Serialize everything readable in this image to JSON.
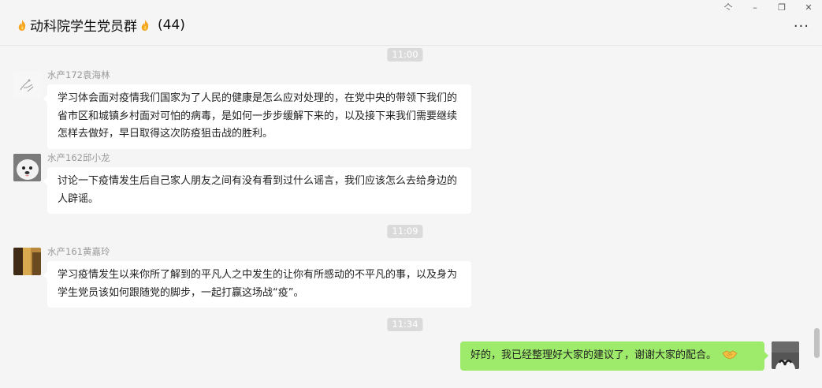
{
  "header": {
    "title": "动科院学生党员群",
    "count": "(44)",
    "window_controls": {
      "pin": "亽",
      "minimize": "–",
      "maximize": "❐",
      "close": "✕"
    },
    "menu": "···"
  },
  "messages": [
    {
      "type": "time",
      "text": "11:00"
    },
    {
      "type": "msg",
      "sender": "水产172袁海林",
      "text": "学习体会面对疫情我们国家为了人民的健康是怎么应对处理的，在党中央的带领下我们的省市区和城镇乡村面对可怕的病毒，是如何一步步缓解下来的，以及接下来我们需要继续怎样去做好，早日取得这次防疫狙击战的胜利。"
    },
    {
      "type": "msg",
      "sender": "水产162邱小龙",
      "text": "讨论一下疫情发生后自己家人朋友之间有没有看到过什么谣言，我们应该怎么去给身边的人辟谣。"
    },
    {
      "type": "time",
      "text": "11:09"
    },
    {
      "type": "msg",
      "sender": "水产161黄嘉玲",
      "text": "学习疫情发生以来你所了解到的平凡人之中发生的让你有所感动的不平凡的事，以及身为学生党员该如何跟随党的脚步，一起打赢这场战“疫”。"
    },
    {
      "type": "time",
      "text": "11:34"
    },
    {
      "type": "self",
      "text": "好的，我已经整理好大家的建议了，谢谢大家的配合。",
      "emoji": "handshake-emoji"
    }
  ],
  "colors": {
    "self_bubble": "#9eea6a",
    "other_bubble": "#ffffff",
    "background": "#f5f5f5",
    "time_badge": "#dadada"
  }
}
